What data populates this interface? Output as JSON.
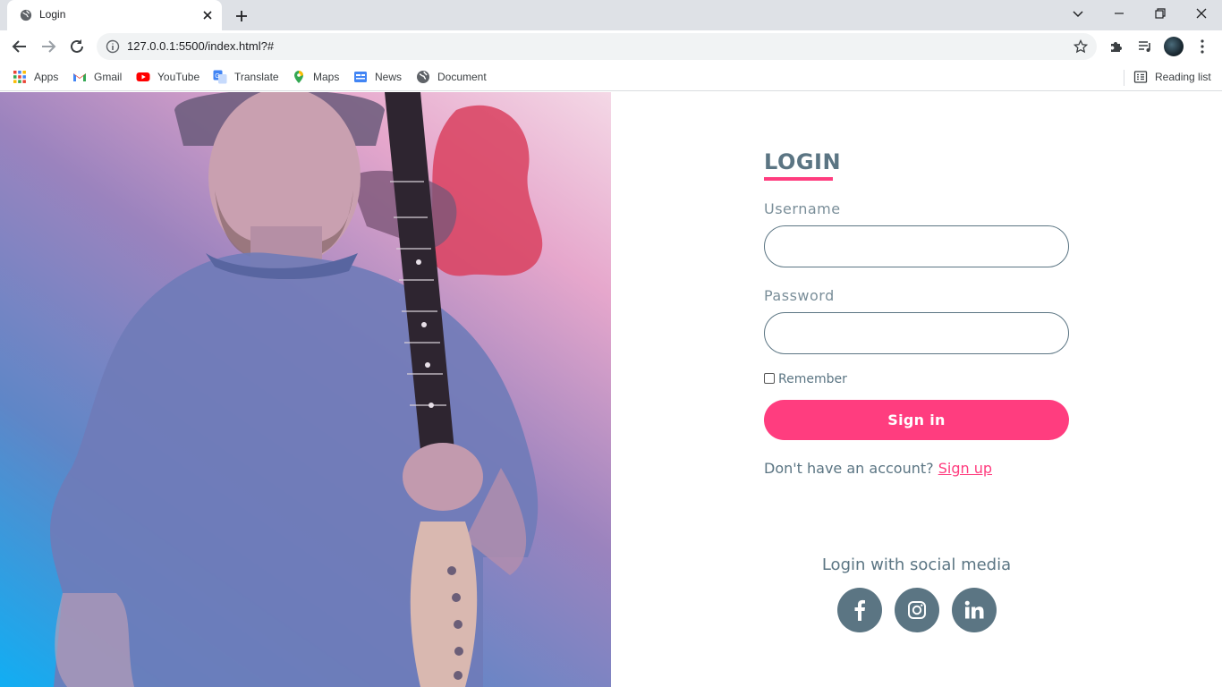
{
  "browser": {
    "tab_title": "Login",
    "url": "127.0.0.1:5500/index.html?#",
    "bookmarks": [
      {
        "label": "Apps",
        "icon": "apps-grid-icon"
      },
      {
        "label": "Gmail",
        "icon": "gmail-icon"
      },
      {
        "label": "YouTube",
        "icon": "youtube-icon"
      },
      {
        "label": "Translate",
        "icon": "translate-icon"
      },
      {
        "label": "Maps",
        "icon": "maps-pin-icon"
      },
      {
        "label": "News",
        "icon": "news-icon"
      },
      {
        "label": "Document",
        "icon": "globe-icon"
      }
    ],
    "reading_list": "Reading list"
  },
  "login": {
    "title": "LOGIN",
    "username_label": "Username",
    "username_value": "",
    "password_label": "Password",
    "password_value": "",
    "remember_label": "Remember",
    "remember_checked": false,
    "signin_label": "Sign in",
    "no_account_text": "Don't have an account?",
    "signup_label": "Sign up",
    "social_title": "Login with social media",
    "social": [
      {
        "name": "facebook",
        "icon": "facebook-icon"
      },
      {
        "name": "instagram",
        "icon": "instagram-icon"
      },
      {
        "name": "linkedin",
        "icon": "linkedin-icon"
      }
    ]
  },
  "colors": {
    "accent": "#ff3d7f",
    "slate": "#5b7583",
    "hero_gradient": [
      "#11aef3",
      "#9b83be",
      "#f4d8e6"
    ]
  }
}
